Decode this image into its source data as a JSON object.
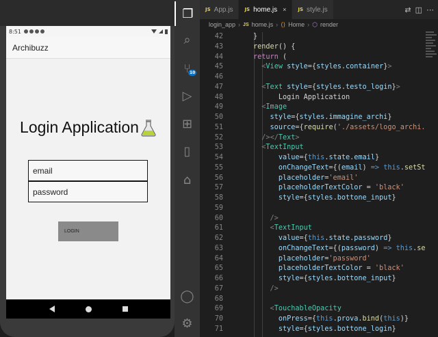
{
  "phone": {
    "status_time": "8:51",
    "app_bar_title": "Archibuzz",
    "screen_title": "Login Application",
    "email_placeholder": "email",
    "password_placeholder": "password",
    "login_button": "LOGIN"
  },
  "editor": {
    "tabs": [
      {
        "label": "App.js",
        "badge": "JS",
        "active": false
      },
      {
        "label": "home.js",
        "badge": "JS",
        "active": true
      },
      {
        "label": "style.js",
        "badge": "JS",
        "active": false
      }
    ],
    "breadcrumb": [
      "login_app",
      "home.js",
      "Home",
      "render"
    ],
    "scm_badge": "10",
    "lines": [
      {
        "n": "42",
        "indent": 6,
        "tokens": [
          [
            "}",
            "#d4d4d4"
          ]
        ]
      },
      {
        "n": "43",
        "indent": 6,
        "tokens": [
          [
            "render",
            "#dcdcaa"
          ],
          [
            "() {",
            "#d4d4d4"
          ]
        ]
      },
      {
        "n": "44",
        "indent": 6,
        "tokens": [
          [
            "return",
            "#c586c0"
          ],
          [
            " (",
            "#d4d4d4"
          ]
        ]
      },
      {
        "n": "45",
        "indent": 8,
        "tokens": [
          [
            "<",
            "#808080"
          ],
          [
            "View",
            "#4ec9b0"
          ],
          [
            " style",
            "#9cdcfe"
          ],
          [
            "={",
            "#d4d4d4"
          ],
          [
            "styles",
            "#9cdcfe"
          ],
          [
            ".",
            "#d4d4d4"
          ],
          [
            "container",
            "#9cdcfe"
          ],
          [
            "}",
            "#d4d4d4"
          ],
          [
            ">",
            "#808080"
          ]
        ]
      },
      {
        "n": "46",
        "indent": 0,
        "tokens": []
      },
      {
        "n": "47",
        "indent": 8,
        "tokens": [
          [
            "<",
            "#808080"
          ],
          [
            "Text",
            "#4ec9b0"
          ],
          [
            " style",
            "#9cdcfe"
          ],
          [
            "={",
            "#d4d4d4"
          ],
          [
            "styles",
            "#9cdcfe"
          ],
          [
            ".",
            "#d4d4d4"
          ],
          [
            "testo_login",
            "#9cdcfe"
          ],
          [
            "}",
            "#d4d4d4"
          ],
          [
            ">",
            "#808080"
          ]
        ]
      },
      {
        "n": "48",
        "indent": 12,
        "tokens": [
          [
            "Login Application",
            "#d4d4d4"
          ]
        ]
      },
      {
        "n": "49",
        "indent": 8,
        "tokens": [
          [
            "<",
            "#808080"
          ],
          [
            "Image",
            "#4ec9b0"
          ]
        ]
      },
      {
        "n": "50",
        "indent": 10,
        "tokens": [
          [
            "style",
            "#9cdcfe"
          ],
          [
            "={",
            "#d4d4d4"
          ],
          [
            "styles",
            "#9cdcfe"
          ],
          [
            ".",
            "#d4d4d4"
          ],
          [
            "immagine_archi",
            "#9cdcfe"
          ],
          [
            "}",
            "#d4d4d4"
          ]
        ]
      },
      {
        "n": "51",
        "indent": 10,
        "tokens": [
          [
            "source",
            "#9cdcfe"
          ],
          [
            "={",
            "#d4d4d4"
          ],
          [
            "require",
            "#dcdcaa"
          ],
          [
            "(",
            "#d4d4d4"
          ],
          [
            "'./assets/logo_archi.",
            "#ce9178"
          ]
        ]
      },
      {
        "n": "52",
        "indent": 8,
        "tokens": [
          [
            "/>",
            "#808080"
          ],
          [
            "</",
            "#808080"
          ],
          [
            "Text",
            "#4ec9b0"
          ],
          [
            ">",
            "#808080"
          ]
        ]
      },
      {
        "n": "53",
        "indent": 8,
        "tokens": [
          [
            "<",
            "#808080"
          ],
          [
            "TextInput",
            "#4ec9b0"
          ]
        ]
      },
      {
        "n": "54",
        "indent": 12,
        "tokens": [
          [
            "value",
            "#9cdcfe"
          ],
          [
            "={",
            "#d4d4d4"
          ],
          [
            "this",
            "#569cd6"
          ],
          [
            ".",
            "#d4d4d4"
          ],
          [
            "state",
            "#9cdcfe"
          ],
          [
            ".",
            "#d4d4d4"
          ],
          [
            "email",
            "#9cdcfe"
          ],
          [
            "}",
            "#d4d4d4"
          ]
        ]
      },
      {
        "n": "55",
        "indent": 12,
        "tokens": [
          [
            "onChangeText",
            "#9cdcfe"
          ],
          [
            "={(",
            "#d4d4d4"
          ],
          [
            "email",
            "#9cdcfe"
          ],
          [
            ") ",
            "#d4d4d4"
          ],
          [
            "=>",
            "#569cd6"
          ],
          [
            " ",
            "#d4d4d4"
          ],
          [
            "this",
            "#569cd6"
          ],
          [
            ".",
            "#d4d4d4"
          ],
          [
            "setSt",
            "#dcdcaa"
          ]
        ]
      },
      {
        "n": "56",
        "indent": 12,
        "tokens": [
          [
            "placeholder",
            "#9cdcfe"
          ],
          [
            "=",
            "#d4d4d4"
          ],
          [
            "'email'",
            "#ce9178"
          ]
        ]
      },
      {
        "n": "57",
        "indent": 12,
        "tokens": [
          [
            "placeholderTextColor",
            "#9cdcfe"
          ],
          [
            " = ",
            "#d4d4d4"
          ],
          [
            "'black'",
            "#ce9178"
          ]
        ]
      },
      {
        "n": "58",
        "indent": 12,
        "tokens": [
          [
            "style",
            "#9cdcfe"
          ],
          [
            "={",
            "#d4d4d4"
          ],
          [
            "styles",
            "#9cdcfe"
          ],
          [
            ".",
            "#d4d4d4"
          ],
          [
            "bottone_input",
            "#9cdcfe"
          ],
          [
            "}",
            "#d4d4d4"
          ]
        ]
      },
      {
        "n": "59",
        "indent": 0,
        "tokens": []
      },
      {
        "n": "60",
        "indent": 10,
        "tokens": [
          [
            "/>",
            "#808080"
          ]
        ]
      },
      {
        "n": "61",
        "indent": 10,
        "tokens": [
          [
            "<",
            "#808080"
          ],
          [
            "TextInput",
            "#4ec9b0"
          ]
        ]
      },
      {
        "n": "62",
        "indent": 12,
        "tokens": [
          [
            "value",
            "#9cdcfe"
          ],
          [
            "={",
            "#d4d4d4"
          ],
          [
            "this",
            "#569cd6"
          ],
          [
            ".",
            "#d4d4d4"
          ],
          [
            "state",
            "#9cdcfe"
          ],
          [
            ".",
            "#d4d4d4"
          ],
          [
            "password",
            "#9cdcfe"
          ],
          [
            "}",
            "#d4d4d4"
          ]
        ]
      },
      {
        "n": "63",
        "indent": 12,
        "tokens": [
          [
            "onChangeText",
            "#9cdcfe"
          ],
          [
            "={(",
            "#d4d4d4"
          ],
          [
            "password",
            "#9cdcfe"
          ],
          [
            ") ",
            "#d4d4d4"
          ],
          [
            "=>",
            "#569cd6"
          ],
          [
            " ",
            "#d4d4d4"
          ],
          [
            "this",
            "#569cd6"
          ],
          [
            ".",
            "#d4d4d4"
          ],
          [
            "se",
            "#dcdcaa"
          ]
        ]
      },
      {
        "n": "64",
        "indent": 12,
        "tokens": [
          [
            "placeholder",
            "#9cdcfe"
          ],
          [
            "=",
            "#d4d4d4"
          ],
          [
            "'password'",
            "#ce9178"
          ]
        ]
      },
      {
        "n": "65",
        "indent": 12,
        "tokens": [
          [
            "placeholderTextColor",
            "#9cdcfe"
          ],
          [
            " = ",
            "#d4d4d4"
          ],
          [
            "'black'",
            "#ce9178"
          ]
        ]
      },
      {
        "n": "66",
        "indent": 12,
        "tokens": [
          [
            "style",
            "#9cdcfe"
          ],
          [
            "={",
            "#d4d4d4"
          ],
          [
            "styles",
            "#9cdcfe"
          ],
          [
            ".",
            "#d4d4d4"
          ],
          [
            "bottone_input",
            "#9cdcfe"
          ],
          [
            "}",
            "#d4d4d4"
          ]
        ]
      },
      {
        "n": "67",
        "indent": 10,
        "tokens": [
          [
            "/>",
            "#808080"
          ]
        ]
      },
      {
        "n": "68",
        "indent": 0,
        "tokens": []
      },
      {
        "n": "69",
        "indent": 10,
        "tokens": [
          [
            "<",
            "#808080"
          ],
          [
            "TouchableOpacity",
            "#4ec9b0"
          ]
        ]
      },
      {
        "n": "70",
        "indent": 12,
        "tokens": [
          [
            "onPress",
            "#9cdcfe"
          ],
          [
            "={",
            "#d4d4d4"
          ],
          [
            "this",
            "#569cd6"
          ],
          [
            ".",
            "#d4d4d4"
          ],
          [
            "prova",
            "#9cdcfe"
          ],
          [
            ".",
            "#d4d4d4"
          ],
          [
            "bind",
            "#dcdcaa"
          ],
          [
            "(",
            "#d4d4d4"
          ],
          [
            "this",
            "#569cd6"
          ],
          [
            ")}",
            "#d4d4d4"
          ]
        ]
      },
      {
        "n": "71",
        "indent": 12,
        "tokens": [
          [
            "style",
            "#9cdcfe"
          ],
          [
            "={",
            "#d4d4d4"
          ],
          [
            "styles",
            "#9cdcfe"
          ],
          [
            ".",
            "#d4d4d4"
          ],
          [
            "bottone_login",
            "#9cdcfe"
          ],
          [
            "}",
            "#d4d4d4"
          ]
        ]
      }
    ]
  }
}
